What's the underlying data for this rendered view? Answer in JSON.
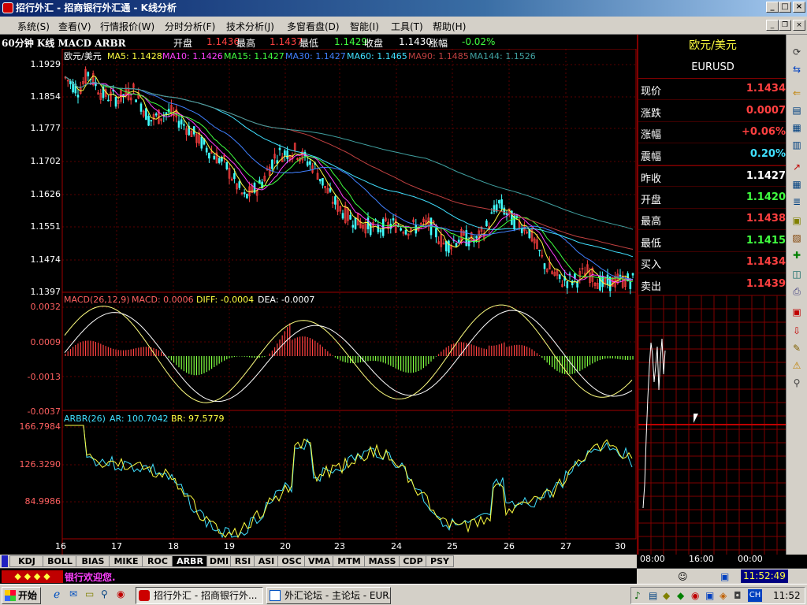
{
  "window": {
    "title": "招行外汇 - 招商银行外汇通 - K线分析"
  },
  "menu": [
    "系统(S)",
    "查看(V)",
    "行情报价(W)",
    "分时分析(F)",
    "技术分析(J)",
    "多窗看盘(D)",
    "智能(I)",
    "工具(T)",
    "帮助(H)"
  ],
  "infobar": {
    "chart_label": "60分钟 K线 MACD ARBR",
    "open_label": "开盘",
    "open_value": "1.1436",
    "high_label": "最高",
    "high_value": "1.1437",
    "low_label": "最低",
    "low_value": "1.1429",
    "close_label": "收盘",
    "close_value": "1.1430",
    "change_label": "涨幅",
    "change_value": "-0.02%"
  },
  "kline": {
    "pair": "欧元/美元",
    "ma5": "MA5: 1.1428",
    "ma10": "MA10: 1.1426",
    "ma15": "MA15: 1.1427",
    "ma30": "MA30: 1.1427",
    "ma60": "MA60: 1.1465",
    "ma90": "MA90: 1.1485",
    "ma144": "MA144: 1.1526",
    "yticks": [
      "1.1929",
      "1.1854",
      "1.1777",
      "1.1702",
      "1.1626",
      "1.1551",
      "1.1474",
      "1.1397"
    ],
    "xticks": [
      "16",
      "17",
      "18",
      "19",
      "20",
      "23",
      "24",
      "25",
      "26",
      "27",
      "30"
    ]
  },
  "macd": {
    "label": "MACD(26,12,9)",
    "macd": "MACD: 0.0006",
    "diff": "DIFF: -0.0004",
    "dea": "DEA: -0.0007",
    "yticks": [
      "0.0032",
      "0.0009",
      "-0.0013",
      "-0.0037"
    ]
  },
  "arbr": {
    "label": "ARBR(26)",
    "ar": "AR: 100.7042",
    "br": "BR: 97.5779",
    "yticks": [
      "166.7984",
      "126.3290",
      "84.9986"
    ]
  },
  "quote": {
    "pair": "欧元/美元",
    "symbol": "EURUSD",
    "rows": [
      {
        "label": "现价",
        "value": "1.1434",
        "color": "#ff4040"
      },
      {
        "label": "涨跌",
        "value": "0.0007",
        "color": "#ff4040"
      },
      {
        "label": "涨幅",
        "value": "+0.06%",
        "color": "#ff4040"
      },
      {
        "label": "震幅",
        "value": "0.20%",
        "color": "#40e0ff"
      },
      {
        "label": "昨收",
        "value": "1.1427",
        "color": "#ffffff"
      },
      {
        "label": "开盘",
        "value": "1.1420",
        "color": "#40ff40"
      },
      {
        "label": "最高",
        "value": "1.1438",
        "color": "#ff4040"
      },
      {
        "label": "最低",
        "value": "1.1415",
        "color": "#40ff40"
      },
      {
        "label": "买入",
        "value": "1.1434",
        "color": "#ff4040"
      },
      {
        "label": "卖出",
        "value": "1.1439",
        "color": "#ff4040"
      }
    ],
    "time_ticks": [
      "08:00",
      "16:00",
      "00:00"
    ]
  },
  "tabs": [
    "KDJ",
    "BOLL",
    "BIAS",
    "MIKE",
    "ROC",
    "ARBR",
    "DMI",
    "RSI",
    "ASI",
    "OSC",
    "VMA",
    "MTM",
    "MASS",
    "CDP",
    "PSY"
  ],
  "selected_tab": "ARBR",
  "status": {
    "welcome": "银行欢迎您.",
    "clock": "11:52:49"
  },
  "taskbar": {
    "start": "开始",
    "tasks": [
      "招行外汇 - 招商银行外...",
      "外汇论坛 - 主论坛 - EUR..."
    ],
    "time": "11:52",
    "ime": "CH"
  }
}
